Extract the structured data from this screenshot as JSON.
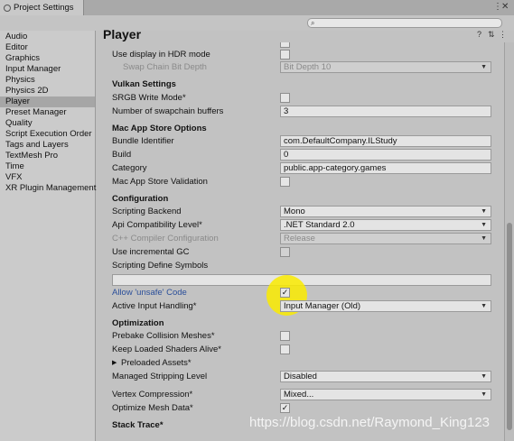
{
  "window": {
    "title": "Project Settings"
  },
  "sidebar": {
    "items": [
      {
        "label": "Audio"
      },
      {
        "label": "Editor"
      },
      {
        "label": "Graphics"
      },
      {
        "label": "Input Manager"
      },
      {
        "label": "Physics"
      },
      {
        "label": "Physics 2D"
      },
      {
        "label": "Player",
        "selected": true
      },
      {
        "label": "Preset Manager"
      },
      {
        "label": "Quality"
      },
      {
        "label": "Script Execution Order"
      },
      {
        "label": "Tags and Layers"
      },
      {
        "label": "TextMesh Pro"
      },
      {
        "label": "Time"
      },
      {
        "label": "VFX"
      },
      {
        "label": "XR Plugin Management"
      }
    ]
  },
  "header": {
    "title": "Player"
  },
  "settings": {
    "hdr_label": "Use display in HDR mode",
    "swapchain_depth_label": "Swap Chain Bit Depth",
    "swapchain_depth_value": "Bit Depth 10",
    "vulkan_heading": "Vulkan Settings",
    "srgb_label": "SRGB Write Mode*",
    "num_swap_label": "Number of swapchain buffers",
    "num_swap_value": "3",
    "mac_heading": "Mac App Store Options",
    "bundle_label": "Bundle Identifier",
    "bundle_value": "com.DefaultCompany.ILStudy",
    "build_label": "Build",
    "build_value": "0",
    "category_label": "Category",
    "category_value": "public.app-category.games",
    "mac_validation_label": "Mac App Store Validation",
    "config_heading": "Configuration",
    "backend_label": "Scripting Backend",
    "backend_value": "Mono",
    "api_label": "Api Compatibility Level*",
    "api_value": ".NET Standard 2.0",
    "cpp_label": "C++ Compiler Configuration",
    "cpp_value": "Release",
    "incremental_gc_label": "Use incremental GC",
    "define_symbols_label": "Scripting Define Symbols",
    "unsafe_label": "Allow 'unsafe' Code",
    "input_handling_label": "Active Input Handling*",
    "input_handling_value": "Input Manager (Old)",
    "opt_heading": "Optimization",
    "prebake_label": "Prebake Collision Meshes*",
    "keep_shaders_label": "Keep Loaded Shaders Alive*",
    "preloaded_label": "Preloaded Assets*",
    "stripping_label": "Managed Stripping Level",
    "stripping_value": "Disabled",
    "vertex_label": "Vertex Compression*",
    "vertex_value": "Mixed...",
    "optimize_mesh_label": "Optimize Mesh Data*",
    "stack_heading": "Stack Trace*",
    "check_mark": "✓"
  },
  "watermark": "https://blog.csdn.net/Raymond_King123"
}
